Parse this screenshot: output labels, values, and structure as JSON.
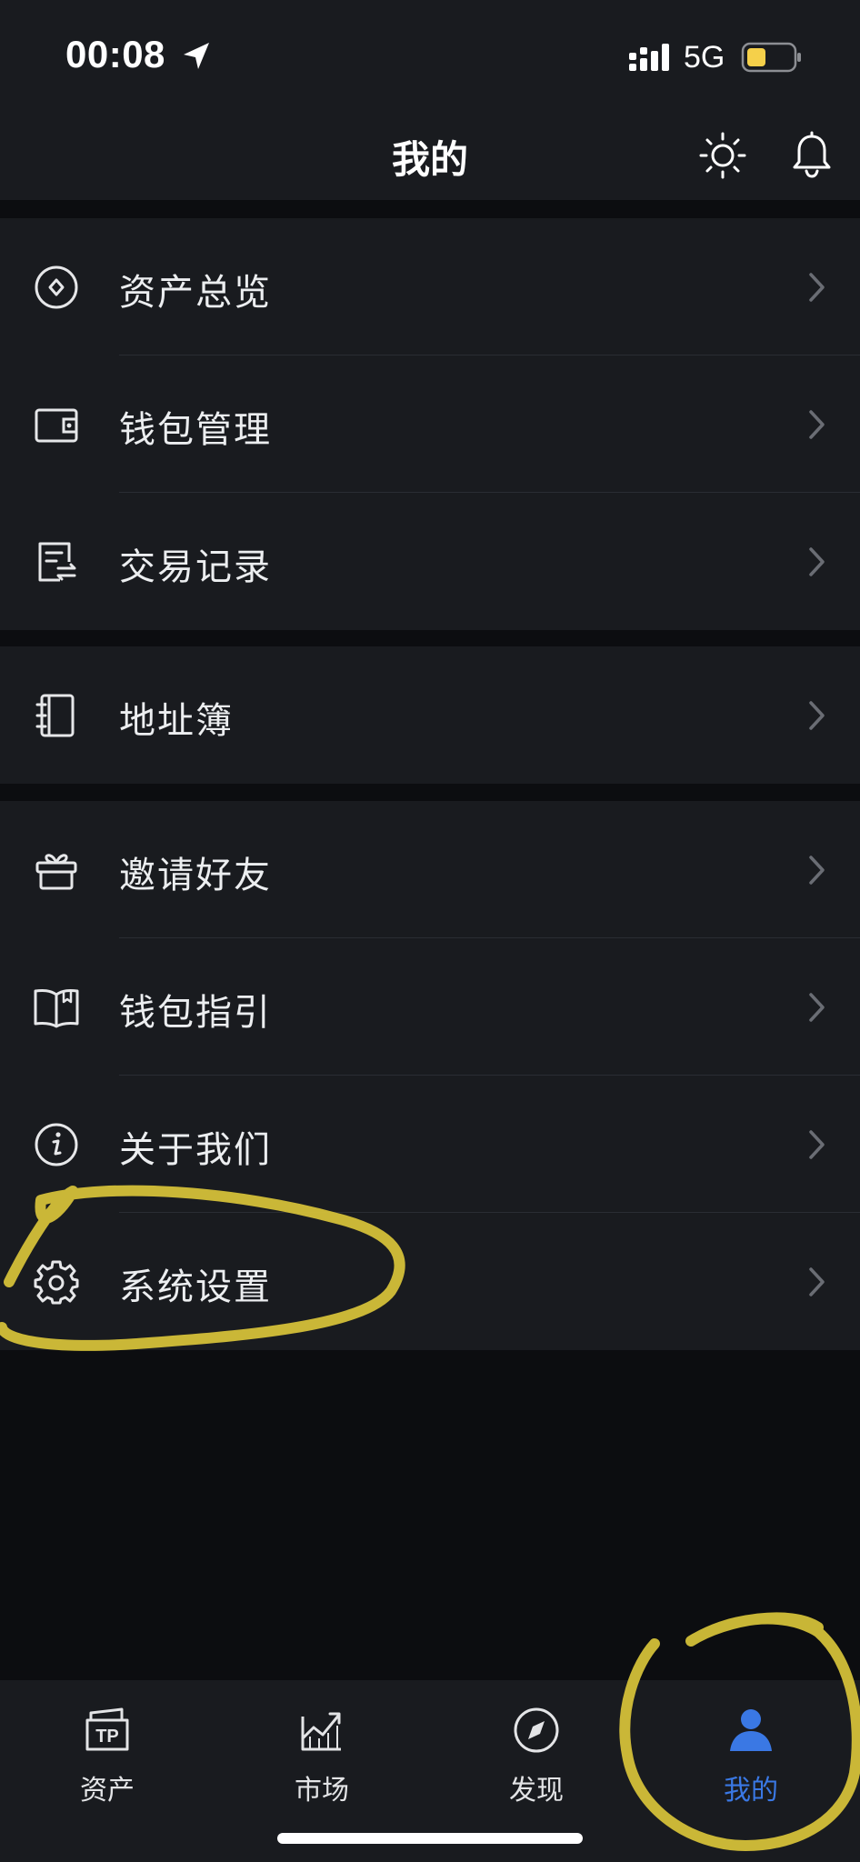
{
  "status_bar": {
    "time": "00:08",
    "network": "5G",
    "icons": [
      "location-arrow-icon",
      "signal-bars-icon",
      "battery-icon"
    ],
    "battery_color": "#f5d04a"
  },
  "nav": {
    "title": "我的",
    "icons": [
      "sun-icon",
      "bell-icon"
    ]
  },
  "menu_groups": [
    {
      "items": [
        {
          "label": "资产总览",
          "icon": "asset-overview-icon"
        },
        {
          "label": "钱包管理",
          "icon": "wallet-icon"
        },
        {
          "label": "交易记录",
          "icon": "transaction-record-icon"
        }
      ]
    },
    {
      "items": [
        {
          "label": "地址簿",
          "icon": "address-book-icon"
        }
      ]
    },
    {
      "items": [
        {
          "label": "邀请好友",
          "icon": "gift-icon"
        },
        {
          "label": "钱包指引",
          "icon": "book-icon"
        },
        {
          "label": "关于我们",
          "icon": "info-icon"
        },
        {
          "label": "系统设置",
          "icon": "gear-icon"
        }
      ]
    }
  ],
  "tab_bar": {
    "tabs": [
      {
        "label": "资产",
        "icon": "tp-wallet-icon",
        "active": false
      },
      {
        "label": "市场",
        "icon": "market-chart-icon",
        "active": false
      },
      {
        "label": "发现",
        "icon": "compass-icon",
        "active": false
      },
      {
        "label": "我的",
        "icon": "person-icon",
        "active": true
      }
    ],
    "active_color": "#3a78e4"
  },
  "annotation_color": "#d9c43a"
}
